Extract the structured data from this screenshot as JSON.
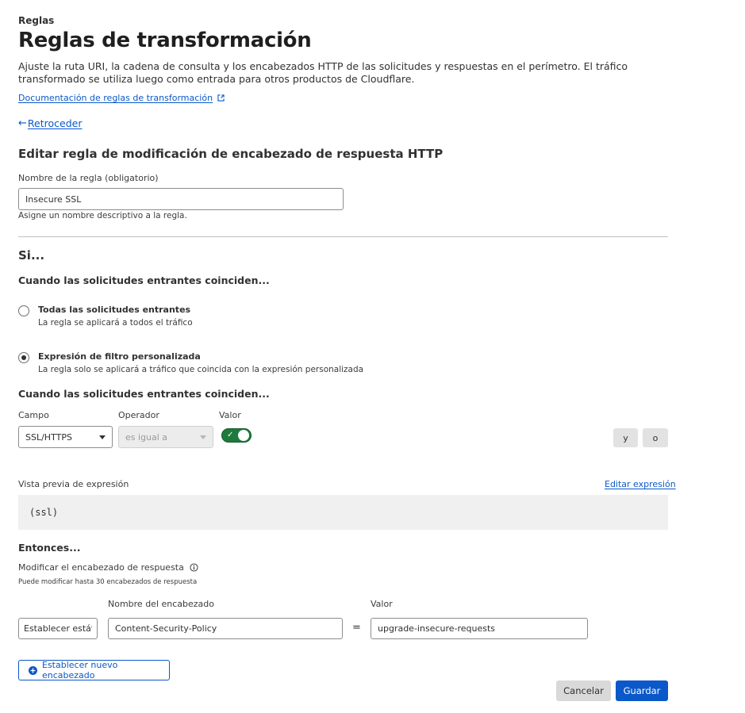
{
  "header": {
    "eyebrow": "Reglas",
    "title": "Reglas de transformación",
    "description": "Ajuste la ruta URI, la cadena de consulta y los encabezados HTTP de las solicitudes y respuestas en el perímetro. El tráfico transformado se utiliza luego como entrada para otros productos de Cloudflare.",
    "doc_link": "Documentación de reglas de transformación",
    "back_label": "Retroceder",
    "back_arrow": "←"
  },
  "form": {
    "heading": "Editar regla de modificación de encabezado de respuesta HTTP",
    "rule_name_label": "Nombre de la regla (obligatorio)",
    "rule_name_value": "Insecure SSL",
    "rule_name_hint": "Asigne un nombre descriptivo a la regla."
  },
  "if_section": {
    "title": "Si...",
    "match_heading": "Cuando las solicitudes entrantes coinciden...",
    "options": [
      {
        "title": "Todas las solicitudes entrantes",
        "desc": "La regla se aplicará a todos el tráfico",
        "checked": false
      },
      {
        "title": "Expresión de filtro personalizada",
        "desc": "La regla solo se aplicará a tráfico que coincida con la expresión personalizada",
        "checked": true
      }
    ],
    "expr_heading": "Cuando las solicitudes entrantes coinciden...",
    "field_label": "Campo",
    "field_value": "SSL/HTTPS",
    "operator_label": "Operador",
    "operator_value": "es igual a",
    "value_label": "Valor",
    "value_toggle": true,
    "and_button": "y",
    "or_button": "o",
    "preview_label": "Vista previa de expresión",
    "edit_expression": "Editar expresión",
    "preview_code": "(ssl)"
  },
  "then_section": {
    "title": "Entonces...",
    "modify_label": "Modificar el encabezado de respuesta",
    "modify_hint": "Puede modificar hasta 30 encabezados de respuesta",
    "action_value": "Establecer estático",
    "header_name_label": "Nombre del encabezado",
    "header_name_value": "Content-Security-Policy",
    "equals": "=",
    "value_label": "Valor",
    "value_value": "upgrade-insecure-requests",
    "add_header": "Establecer nuevo encabezado"
  },
  "footer": {
    "cancel": "Cancelar",
    "save": "Guardar"
  },
  "colors": {
    "accent": "#0a58c9",
    "toggle_on": "#1e7a3c",
    "text": "#313131"
  },
  "icons": [
    "external-link-icon",
    "back-arrow-icon",
    "chevron-down-icon",
    "check-icon",
    "info-icon",
    "plus-circle-icon"
  ]
}
